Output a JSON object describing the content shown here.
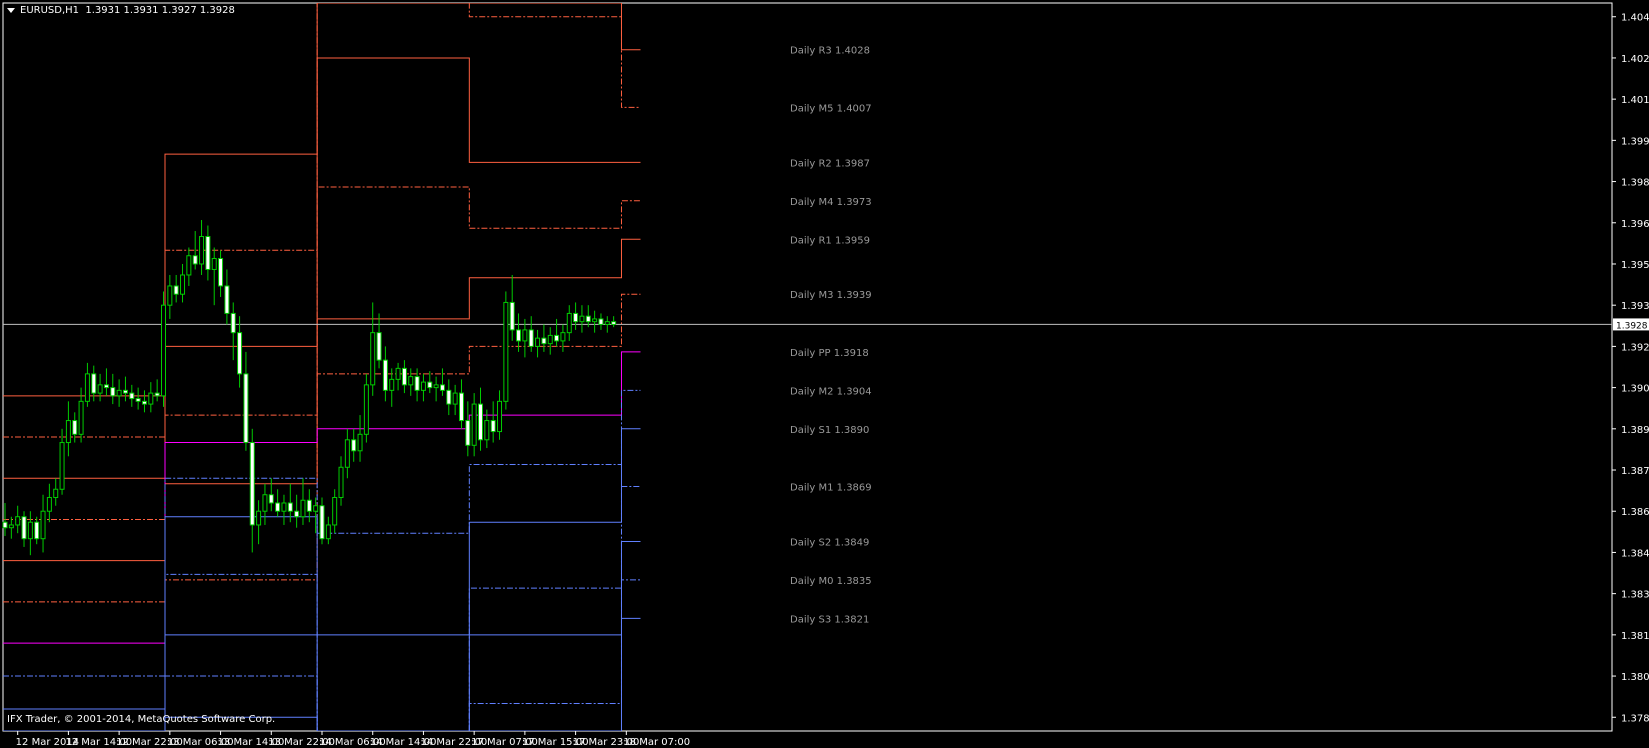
{
  "header": {
    "symbol": "EURUSD,H1",
    "ohlc": "1.3931 1.3931 1.3927 1.3928"
  },
  "copyright": "IFX Trader, © 2001-2014, MetaQuotes Software Corp.",
  "colors": {
    "background": "#000000",
    "axis": "#ffffff",
    "bull": "#00cc00",
    "bear": "#ffffff",
    "resistance": "#ff6040",
    "pivot": "#ff00ff",
    "support": "#6080ff",
    "label": "#999999",
    "price_line": "#c0c0c0"
  },
  "chart_data": {
    "type": "candlestick",
    "symbol": "EURUSD",
    "timeframe": "H1",
    "ylim": [
      1.378,
      1.4045
    ],
    "y_ticks": [
      "1.4040",
      "1.4025",
      "1.4010",
      "1.3995",
      "1.3980",
      "1.3965",
      "1.3950",
      "1.3935",
      "1.3920",
      "1.3905",
      "1.3890",
      "1.3875",
      "1.3860",
      "1.3845",
      "1.3830",
      "1.3815",
      "1.3800",
      "1.3785"
    ],
    "x_ticks": [
      {
        "bar": 2,
        "label": "12 Mar 2014"
      },
      {
        "bar": 10,
        "label": "12 Mar 14:00"
      },
      {
        "bar": 18,
        "label": "12 Mar 22:00"
      },
      {
        "bar": 26,
        "label": "13 Mar 06:00"
      },
      {
        "bar": 34,
        "label": "13 Mar 14:00"
      },
      {
        "bar": 42,
        "label": "13 Mar 22:00"
      },
      {
        "bar": 50,
        "label": "14 Mar 06:00"
      },
      {
        "bar": 58,
        "label": "14 Mar 14:00"
      },
      {
        "bar": 66,
        "label": "14 Mar 22:00"
      },
      {
        "bar": 74,
        "label": "17 Mar 07:00"
      },
      {
        "bar": 82,
        "label": "17 Mar 15:00"
      },
      {
        "bar": 90,
        "label": "17 Mar 23:00"
      },
      {
        "bar": 98,
        "label": "18 Mar 07:00"
      }
    ],
    "current_price": 1.3928,
    "current_price_label": "1.3928",
    "bars_total": 100,
    "candles": [
      [
        1.3856,
        1.3863,
        1.3851,
        1.3854
      ],
      [
        1.3854,
        1.3858,
        1.385,
        1.3855
      ],
      [
        1.3855,
        1.3862,
        1.3852,
        1.3858
      ],
      [
        1.3858,
        1.386,
        1.3847,
        1.385
      ],
      [
        1.385,
        1.386,
        1.3844,
        1.3856
      ],
      [
        1.3856,
        1.3858,
        1.3848,
        1.385
      ],
      [
        1.385,
        1.3866,
        1.3845,
        1.386
      ],
      [
        1.386,
        1.387,
        1.3856,
        1.3865
      ],
      [
        1.3865,
        1.3872,
        1.3862,
        1.3868
      ],
      [
        1.3868,
        1.389,
        1.3866,
        1.3885
      ],
      [
        1.3885,
        1.39,
        1.388,
        1.3893
      ],
      [
        1.3893,
        1.3896,
        1.3885,
        1.3888
      ],
      [
        1.3888,
        1.3905,
        1.3885,
        1.39
      ],
      [
        1.39,
        1.3914,
        1.3898,
        1.391
      ],
      [
        1.391,
        1.3913,
        1.39,
        1.3903
      ],
      [
        1.3903,
        1.391,
        1.39,
        1.3906
      ],
      [
        1.3906,
        1.3912,
        1.3902,
        1.3905
      ],
      [
        1.3905,
        1.391,
        1.3899,
        1.3902
      ],
      [
        1.3902,
        1.3908,
        1.3898,
        1.3904
      ],
      [
        1.3904,
        1.3909,
        1.39,
        1.3903
      ],
      [
        1.3903,
        1.3906,
        1.3898,
        1.3901
      ],
      [
        1.3901,
        1.3905,
        1.3897,
        1.39
      ],
      [
        1.39,
        1.3904,
        1.3896,
        1.3899
      ],
      [
        1.3899,
        1.3907,
        1.3896,
        1.3903
      ],
      [
        1.3903,
        1.3908,
        1.39,
        1.3902
      ],
      [
        1.3902,
        1.394,
        1.3898,
        1.3935
      ],
      [
        1.3935,
        1.3946,
        1.393,
        1.3942
      ],
      [
        1.3942,
        1.3946,
        1.3936,
        1.3939
      ],
      [
        1.3939,
        1.395,
        1.3936,
        1.3946
      ],
      [
        1.3946,
        1.3956,
        1.3942,
        1.3953
      ],
      [
        1.3953,
        1.3962,
        1.3948,
        1.395
      ],
      [
        1.395,
        1.3966,
        1.3946,
        1.396
      ],
      [
        1.396,
        1.3964,
        1.3944,
        1.3948
      ],
      [
        1.3948,
        1.3956,
        1.3935,
        1.3952
      ],
      [
        1.3952,
        1.3955,
        1.3938,
        1.3942
      ],
      [
        1.3942,
        1.3948,
        1.3928,
        1.3932
      ],
      [
        1.3932,
        1.3936,
        1.3915,
        1.3925
      ],
      [
        1.3925,
        1.3931,
        1.3905,
        1.391
      ],
      [
        1.391,
        1.3918,
        1.3882,
        1.3885
      ],
      [
        1.3885,
        1.389,
        1.3845,
        1.3855
      ],
      [
        1.3855,
        1.3864,
        1.3848,
        1.386
      ],
      [
        1.386,
        1.387,
        1.3855,
        1.3866
      ],
      [
        1.3866,
        1.3872,
        1.386,
        1.3863
      ],
      [
        1.3863,
        1.3868,
        1.3858,
        1.386
      ],
      [
        1.386,
        1.3866,
        1.3855,
        1.3863
      ],
      [
        1.3863,
        1.387,
        1.3856,
        1.386
      ],
      [
        1.386,
        1.3866,
        1.3854,
        1.3858
      ],
      [
        1.3858,
        1.3872,
        1.3855,
        1.3864
      ],
      [
        1.3864,
        1.3868,
        1.3856,
        1.386
      ],
      [
        1.386,
        1.3865,
        1.3852,
        1.3862
      ],
      [
        1.3862,
        1.3865,
        1.3848,
        1.385
      ],
      [
        1.385,
        1.3858,
        1.3848,
        1.3855
      ],
      [
        1.3855,
        1.3868,
        1.3852,
        1.3865
      ],
      [
        1.3865,
        1.388,
        1.3862,
        1.3876
      ],
      [
        1.3876,
        1.389,
        1.3872,
        1.3886
      ],
      [
        1.3886,
        1.389,
        1.3878,
        1.3882
      ],
      [
        1.3882,
        1.3895,
        1.3878,
        1.3888
      ],
      [
        1.3888,
        1.391,
        1.3885,
        1.3906
      ],
      [
        1.3906,
        1.3936,
        1.3902,
        1.3925
      ],
      [
        1.3925,
        1.3932,
        1.3912,
        1.3915
      ],
      [
        1.3915,
        1.392,
        1.39,
        1.3904
      ],
      [
        1.3904,
        1.3912,
        1.3898,
        1.3908
      ],
      [
        1.3908,
        1.3914,
        1.3904,
        1.3912
      ],
      [
        1.3912,
        1.3915,
        1.3903,
        1.3906
      ],
      [
        1.3906,
        1.3912,
        1.3902,
        1.3909
      ],
      [
        1.3909,
        1.3912,
        1.39,
        1.3904
      ],
      [
        1.3904,
        1.391,
        1.39,
        1.3907
      ],
      [
        1.3907,
        1.3911,
        1.3903,
        1.3905
      ],
      [
        1.3905,
        1.3909,
        1.39,
        1.3906
      ],
      [
        1.3906,
        1.3912,
        1.3902,
        1.3904
      ],
      [
        1.3904,
        1.3908,
        1.3895,
        1.3899
      ],
      [
        1.3899,
        1.3906,
        1.3895,
        1.3903
      ],
      [
        1.3903,
        1.3908,
        1.389,
        1.3893
      ],
      [
        1.3893,
        1.39,
        1.388,
        1.3884
      ],
      [
        1.3884,
        1.3903,
        1.388,
        1.3899
      ],
      [
        1.3899,
        1.3905,
        1.3882,
        1.3886
      ],
      [
        1.3886,
        1.3897,
        1.3883,
        1.3893
      ],
      [
        1.3893,
        1.39,
        1.3885,
        1.3889
      ],
      [
        1.3889,
        1.3904,
        1.3886,
        1.39
      ],
      [
        1.39,
        1.394,
        1.3897,
        1.3936
      ],
      [
        1.3936,
        1.3946,
        1.3922,
        1.3926
      ],
      [
        1.3926,
        1.3932,
        1.3918,
        1.3922
      ],
      [
        1.3922,
        1.393,
        1.3916,
        1.3926
      ],
      [
        1.3926,
        1.3931,
        1.3918,
        1.392
      ],
      [
        1.392,
        1.3926,
        1.3916,
        1.3923
      ],
      [
        1.3923,
        1.3928,
        1.3918,
        1.3921
      ],
      [
        1.3921,
        1.3927,
        1.3917,
        1.3924
      ],
      [
        1.3924,
        1.393,
        1.392,
        1.3922
      ],
      [
        1.3922,
        1.3928,
        1.3918,
        1.3925
      ],
      [
        1.3925,
        1.3935,
        1.3922,
        1.3932
      ],
      [
        1.3932,
        1.3936,
        1.3926,
        1.3929
      ],
      [
        1.3929,
        1.3935,
        1.3925,
        1.3931
      ],
      [
        1.3931,
        1.3935,
        1.3927,
        1.3929
      ],
      [
        1.3929,
        1.3933,
        1.3925,
        1.393
      ],
      [
        1.393,
        1.3932,
        1.3926,
        1.3928
      ],
      [
        1.3928,
        1.3931,
        1.3925,
        1.3929
      ],
      [
        1.3929,
        1.3931,
        1.3927,
        1.3928
      ]
    ],
    "pivot_levels": [
      {
        "name": "R3",
        "label": "Daily R3 1.4028",
        "style": "solid",
        "group": "resistance",
        "values": [
          1.3902,
          1.399,
          1.4105,
          1.4085,
          1.4028
        ]
      },
      {
        "name": "M5",
        "label": "Daily M5 1.4007",
        "style": "dashdot",
        "group": "resistance",
        "values": [
          1.3887,
          1.3955,
          1.4065,
          1.404,
          1.4007
        ]
      },
      {
        "name": "R2",
        "label": "Daily R2 1.3987",
        "style": "solid",
        "group": "resistance",
        "values": [
          1.3872,
          1.392,
          1.4025,
          1.3987,
          1.3987
        ]
      },
      {
        "name": "M4",
        "label": "Daily M4 1.3973",
        "style": "dashdot",
        "group": "resistance",
        "values": [
          1.3857,
          1.3895,
          1.3978,
          1.3963,
          1.3973
        ]
      },
      {
        "name": "R1",
        "label": "Daily R1 1.3959",
        "style": "solid",
        "group": "resistance",
        "values": [
          1.3842,
          1.387,
          1.393,
          1.3945,
          1.3959
        ]
      },
      {
        "name": "M3",
        "label": "Daily M3 1.3939",
        "style": "dashdot",
        "group": "resistance",
        "values": [
          1.3827,
          1.3835,
          1.391,
          1.392,
          1.3939
        ]
      },
      {
        "name": "PP",
        "label": "Daily PP 1.3918",
        "style": "solid",
        "group": "pivot",
        "values": [
          1.3812,
          1.3885,
          1.389,
          1.3895,
          1.3918
        ]
      },
      {
        "name": "M2",
        "label": "Daily M2 1.3904",
        "style": "dashdot",
        "group": "support",
        "values": [
          1.38,
          1.3872,
          1.3852,
          1.3877,
          1.3904
        ]
      },
      {
        "name": "S1",
        "label": "Daily S1 1.3890",
        "style": "solid",
        "group": "support",
        "values": [
          1.3788,
          1.3858,
          1.3815,
          1.3856,
          1.389
        ]
      },
      {
        "name": "M1",
        "label": "Daily M1 1.3869",
        "style": "dashdot",
        "group": "support",
        "values": [
          1.3775,
          1.3837,
          1.378,
          1.3832,
          1.3869
        ]
      },
      {
        "name": "S2",
        "label": "Daily S2 1.3849",
        "style": "solid",
        "group": "support",
        "values": [
          1.3765,
          1.3815,
          1.374,
          1.3815,
          1.3849
        ]
      },
      {
        "name": "M0",
        "label": "Daily M0 1.3835",
        "style": "dashdot",
        "group": "support",
        "values": [
          1.3755,
          1.38,
          1.3705,
          1.379,
          1.3835
        ]
      },
      {
        "name": "S3",
        "label": "Daily S3 1.3821",
        "style": "solid",
        "group": "support",
        "values": [
          1.3745,
          1.3785,
          1.367,
          1.377,
          1.3821
        ]
      }
    ],
    "pivot_sessions": [
      {
        "start_bar": 0,
        "end_bar": 25
      },
      {
        "start_bar": 25,
        "end_bar": 49
      },
      {
        "start_bar": 49,
        "end_bar": 73
      },
      {
        "start_bar": 73,
        "end_bar": 97
      },
      {
        "start_bar": 97,
        "end_bar": 100
      }
    ]
  }
}
